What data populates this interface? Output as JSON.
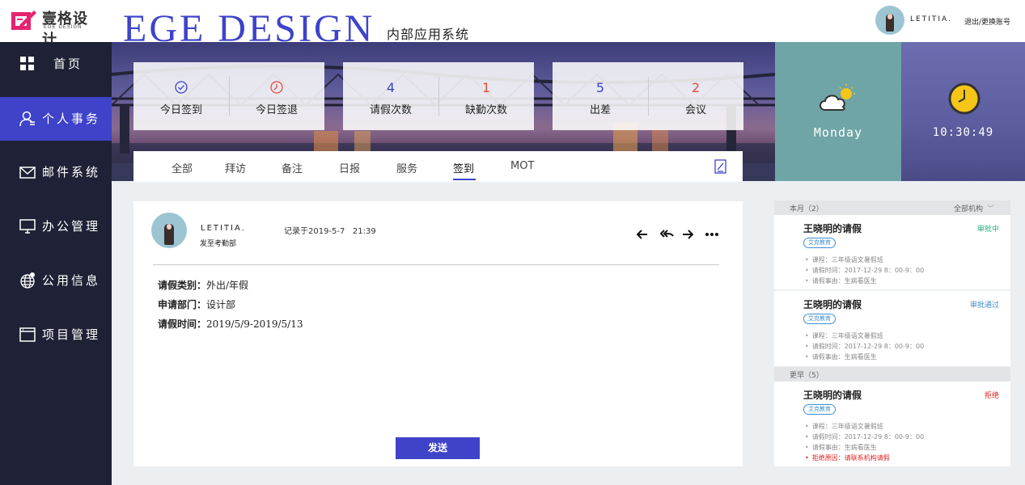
{
  "header": {
    "logo_cn": "壹格设计",
    "logo_en": "EGE DESIGN",
    "brand_en": "EGE DESIGN",
    "brand_cn": "内部应用系统",
    "user_name": "LETITIA.",
    "logout": "退出/更换账号"
  },
  "sidebar": {
    "items": [
      {
        "label": "首页",
        "icon": "grid-icon"
      },
      {
        "label": "个人事务",
        "icon": "user-icon",
        "active": true
      },
      {
        "label": "邮件系统",
        "icon": "mail-icon"
      },
      {
        "label": "办公管理",
        "icon": "monitor-icon"
      },
      {
        "label": "公用信息",
        "icon": "globe-icon"
      },
      {
        "label": "项目管理",
        "icon": "window-icon"
      }
    ]
  },
  "stats": [
    {
      "left": {
        "value": "✓",
        "label": "今日签到"
      },
      "right": {
        "value": "⌚",
        "label": "今日签退"
      }
    },
    {
      "left": {
        "value": "4",
        "label": "请假次数"
      },
      "right": {
        "value": "1",
        "label": "缺勤次数"
      }
    },
    {
      "left": {
        "value": "5",
        "label": "出差"
      },
      "right": {
        "value": "2",
        "label": "会议"
      }
    }
  ],
  "tabs": [
    "全部",
    "拜访",
    "备注",
    "日报",
    "服务",
    "签到",
    "MOT"
  ],
  "active_tab": "签到",
  "weather": {
    "day": "Monday",
    "icon": "cloud-sun-icon"
  },
  "clock": {
    "time": "10:30:49",
    "icon": "clock-icon"
  },
  "message": {
    "name": "LETITIA.",
    "dept": "发至考勤部",
    "time": "记录于2019-5-7   21:39",
    "fields": [
      {
        "label": "请假类别：",
        "value": "外出/年假"
      },
      {
        "label": "申请部门：",
        "value": "设计部"
      },
      {
        "label": "请假时间：",
        "value": "2019/5/9-2019/5/13"
      }
    ],
    "send": "发送"
  },
  "right_panel": {
    "group1": {
      "title": "本月（2）",
      "filter": "全部机构"
    },
    "group2": {
      "title": "更早（5）"
    },
    "cards": [
      {
        "title": "王晓明的请假",
        "status": "审批中",
        "tag": "艾克教育",
        "lines": [
          "课程：三年级语文暑假班",
          "请假时间：2017-12-29 8：00-9：00",
          "请假事由：生病看医生"
        ]
      },
      {
        "title": "王晓明的请假",
        "status": "审批通过",
        "tag": "艾克教育",
        "lines": [
          "课程：三年级语文暑假班",
          "请假时间：2017-12-29 8：00-9：00",
          "请假事由：生病看医生"
        ]
      },
      {
        "title": "王晓明的请假",
        "status": "拒绝",
        "tag": "艾克教育",
        "lines": [
          "课程：三年级语文暑假班",
          "请假时间：2017-12-29 8：00-9：00",
          "请假事由：生病看医生"
        ],
        "reason": "拒绝原因：请联系机构请假"
      }
    ]
  },
  "colors": {
    "accent": "#3e43c9",
    "sidebar": "#1f2236",
    "red": "#e84b3b",
    "green": "#26b17a"
  }
}
